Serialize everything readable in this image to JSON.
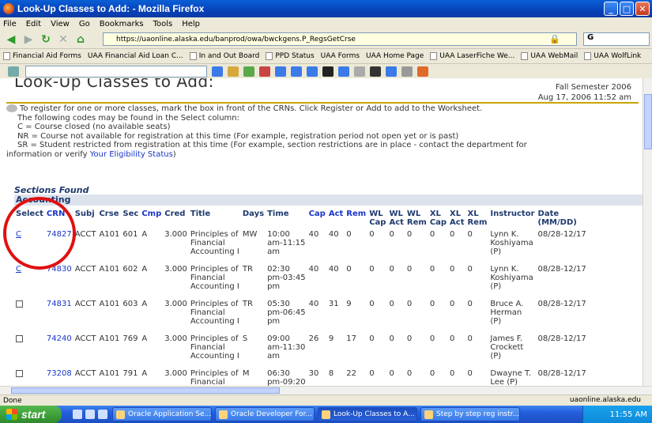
{
  "window": {
    "title": "Look-Up Classes to Add: - Mozilla Firefox"
  },
  "menu": [
    "File",
    "Edit",
    "View",
    "Go",
    "Bookmarks",
    "Tools",
    "Help"
  ],
  "nav": {
    "url": "https://uaonline.alaska.edu/banprod/owa/bwckgens.P_RegsGetCrse",
    "search_value": "G"
  },
  "bookmarks": [
    "Financial Aid Forms",
    "UAA Financial Aid Loan C...",
    "In and Out Board",
    "PPD Status",
    "UAA Forms",
    "UAA Home Page",
    "UAA LaserFiche We...",
    "UAA WebMail",
    "UAA WolfLink"
  ],
  "page": {
    "heading": "Look-Up Classes to Add:",
    "semester": "Fall Semester 2006",
    "datetime": "Aug 17, 2006 11:52 am",
    "info": {
      "line1": "To register for one or more classes, mark the box in front of the CRNs. Click Register or Add to add to the Worksheet.",
      "line2": "The following codes may be found in the Select column:",
      "line3": "C = Course closed (no available seats)",
      "line4": "NR = Course not available for registration at this time (For example, registration period not open yet or is past)",
      "line5": "SR = Student restricted from registration at this time (For example, section restrictions are in place - contact the department for",
      "line6_prefix": "information or verify ",
      "line6_link": "Your Eligibility Status",
      "line6_suffix": ")"
    },
    "sections_found": "Sections Found",
    "department": "Accounting"
  },
  "table": {
    "headers": [
      "Select",
      "CRN",
      "Subj",
      "Crse",
      "Sec",
      "Cmp",
      "Cred",
      "Title",
      "Days",
      "Time",
      "Cap",
      "Act",
      "Rem",
      "WL Cap",
      "WL Act",
      "WL Rem",
      "XL Cap",
      "XL Act",
      "XL Rem",
      "Instructor",
      "Date (MM/DD)"
    ],
    "rows": [
      {
        "select": "C",
        "crn": "74827",
        "subj": "ACCT",
        "crse": "A101",
        "sec": "601",
        "cmp": "A",
        "cred": "3.000",
        "title": [
          "Principles of",
          "Financial",
          "Accounting I"
        ],
        "days": "MW",
        "time": [
          "10:00",
          "am-11:15",
          "am"
        ],
        "cap": "40",
        "act": "40",
        "rem": "0",
        "wlcap": "0",
        "wlact": "0",
        "wlrem": "0",
        "xlcap": "0",
        "xlact": "0",
        "xlrem": "0",
        "instructor": [
          "Lynn K.",
          "Koshiyama",
          "(P)"
        ],
        "date": "08/28-12/17"
      },
      {
        "select": "C",
        "crn": "74830",
        "subj": "ACCT",
        "crse": "A101",
        "sec": "602",
        "cmp": "A",
        "cred": "3.000",
        "title": [
          "Principles of",
          "Financial",
          "Accounting I"
        ],
        "days": "TR",
        "time": [
          "02:30",
          "pm-03:45",
          "pm"
        ],
        "cap": "40",
        "act": "40",
        "rem": "0",
        "wlcap": "0",
        "wlact": "0",
        "wlrem": "0",
        "xlcap": "0",
        "xlact": "0",
        "xlrem": "0",
        "instructor": [
          "Lynn K.",
          "Koshiyama",
          "(P)"
        ],
        "date": "08/28-12/17"
      },
      {
        "select": "",
        "crn": "74831",
        "subj": "ACCT",
        "crse": "A101",
        "sec": "603",
        "cmp": "A",
        "cred": "3.000",
        "title": [
          "Principles of",
          "Financial",
          "Accounting I"
        ],
        "days": "TR",
        "time": [
          "05:30",
          "pm-06:45",
          "pm"
        ],
        "cap": "40",
        "act": "31",
        "rem": "9",
        "wlcap": "0",
        "wlact": "0",
        "wlrem": "0",
        "xlcap": "0",
        "xlact": "0",
        "xlrem": "0",
        "instructor": [
          "Bruce A.",
          "Herman",
          "(P)"
        ],
        "date": "08/28-12/17"
      },
      {
        "select": "",
        "crn": "74240",
        "subj": "ACCT",
        "crse": "A101",
        "sec": "769",
        "cmp": "A",
        "cred": "3.000",
        "title": [
          "Principles of",
          "Financial",
          "Accounting I"
        ],
        "days": "S",
        "time": [
          "09:00",
          "am-11:30",
          "am"
        ],
        "cap": "26",
        "act": "9",
        "rem": "17",
        "wlcap": "0",
        "wlact": "0",
        "wlrem": "0",
        "xlcap": "0",
        "xlact": "0",
        "xlrem": "0",
        "instructor": [
          "James F.",
          "Crockett",
          "(P)"
        ],
        "date": "08/28-12/17"
      },
      {
        "select": "",
        "crn": "73208",
        "subj": "ACCT",
        "crse": "A101",
        "sec": "791",
        "cmp": "A",
        "cred": "3.000",
        "title": [
          "Principles of",
          "Financial",
          "Accounting I"
        ],
        "days": "M",
        "time": [
          "06:30",
          "pm-09:20",
          "pm"
        ],
        "cap": "30",
        "act": "8",
        "rem": "22",
        "wlcap": "0",
        "wlact": "0",
        "wlrem": "0",
        "xlcap": "0",
        "xlact": "0",
        "xlrem": "0",
        "instructor": [
          "Dwayne T.",
          "Lee (P)",
          ""
        ],
        "date": "08/28-12/17"
      }
    ]
  },
  "status": {
    "left": "Done",
    "right": "uaonline.alaska.edu"
  },
  "taskbar": {
    "start": "start",
    "tasks": [
      "Oracle Application Se...",
      "Oracle Developer For...",
      "Look-Up Classes to A...",
      "Step by step reg instr..."
    ],
    "clock": "11:55 AM"
  }
}
